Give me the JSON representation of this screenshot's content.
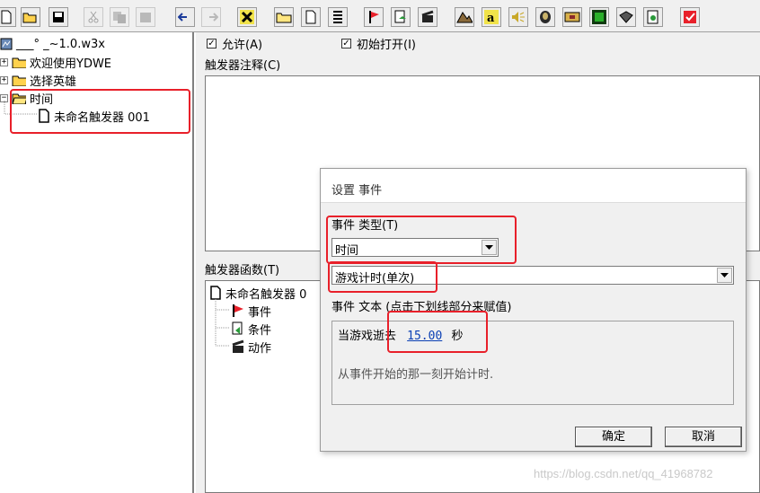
{
  "toolbar": {
    "icons": [
      "new-icon",
      "open-icon",
      "save-icon",
      "cut-icon",
      "copy-icon",
      "paste-icon",
      "undo-icon",
      "redo-icon",
      "delete-icon",
      "new-category-icon",
      "new-trigger-icon",
      "new-comment-icon",
      "new-event-icon",
      "new-condition-icon",
      "new-action-icon",
      "terrain-icon",
      "text-icon",
      "sound-icon",
      "unit-icon",
      "item-icon",
      "object-icon",
      "tool-icon",
      "test-map-icon",
      "check-icon"
    ]
  },
  "tree": {
    "map_name": "___° _~1.0.w3x",
    "items": [
      "欢迎使用YDWE",
      "选择英雄",
      "时间"
    ],
    "trigger": "未命名触发器 001"
  },
  "trigger_editor": {
    "enabled_label": "允许(A)",
    "initially_on_label": "初始打开(I)",
    "comment_label": "触发器注释(C)",
    "functions_label": "触发器函数(T)",
    "fn_root": "未命名触发器 0",
    "fn_event": "事件",
    "fn_condition": "条件",
    "fn_action": "动作"
  },
  "dialog": {
    "title": "设置 事件",
    "type_label": "事件 类型(T)",
    "type_value": "时间",
    "event_value": "游戏计时(单次)",
    "text_label": "事件 文本 (点击下划线部分来赋值)",
    "text_prefix": "当游戏逝去",
    "text_value": "15.00",
    "text_suffix": "秒",
    "description": "从事件开始的那一刻开始计时.",
    "ok_label": "确定",
    "cancel_label": "取消"
  },
  "watermark": "https://blog.csdn.net/qq_41968782",
  "colors": {
    "highlight": "#e8202a",
    "link": "#0a3fb4"
  }
}
